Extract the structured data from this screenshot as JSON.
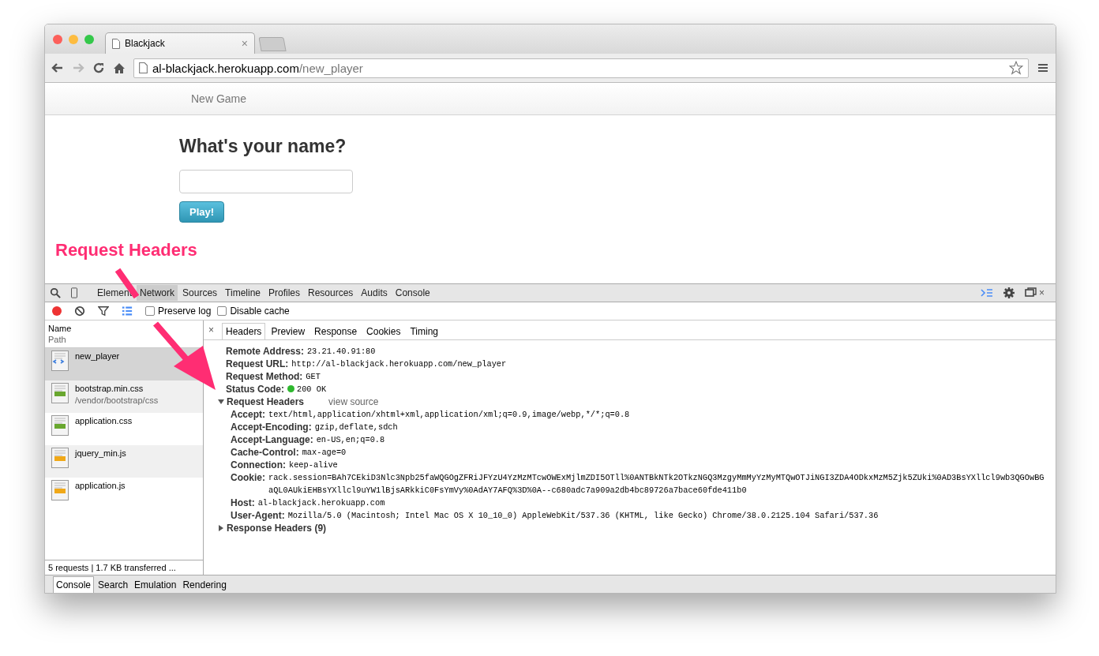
{
  "browser": {
    "tabs": [
      {
        "title": "Blackjack",
        "close": "×",
        "selected": true
      }
    ],
    "address": {
      "host": "al-blackjack.herokuapp.com",
      "path": "/new_player"
    }
  },
  "page": {
    "nav": {
      "link": "New Game"
    },
    "heading": "What's your name?",
    "play_button": "Play!"
  },
  "annotation": {
    "label": "Request Headers"
  },
  "devtools": {
    "panels": [
      {
        "label": "Element",
        "selected": false
      },
      {
        "label": "Network",
        "selected": true
      },
      {
        "label": "Sources",
        "selected": false
      },
      {
        "label": "Timeline",
        "selected": false
      },
      {
        "label": "Profiles",
        "selected": false
      },
      {
        "label": "Resources",
        "selected": false
      },
      {
        "label": "Audits",
        "selected": false
      },
      {
        "label": "Console",
        "selected": false
      }
    ],
    "close": "×",
    "toolbar": {
      "recording": true,
      "checkboxes": [
        {
          "label": "Preserve log",
          "checked": false
        },
        {
          "label": "Disable cache",
          "checked": false
        }
      ]
    },
    "requests_header": {
      "name": "Name",
      "path": "Path"
    },
    "requests": [
      {
        "name": "new_player",
        "kind": "html",
        "selected": true
      },
      {
        "name": "bootstrap.min.css",
        "path": "/vendor/bootstrap/css",
        "kind": "css",
        "selected": false
      },
      {
        "name": "application.css",
        "kind": "css",
        "selected": false
      },
      {
        "name": "jquery_min.js",
        "kind": "js",
        "selected": false
      },
      {
        "name": "application.js",
        "kind": "js",
        "selected": false
      }
    ],
    "summary": "5 requests | 1.7 KB transferred ...",
    "detail_close": "×",
    "detail_tabs": [
      {
        "label": "Headers",
        "selected": true
      },
      {
        "label": "Preview",
        "selected": false
      },
      {
        "label": "Response",
        "selected": false
      },
      {
        "label": "Cookies",
        "selected": false
      },
      {
        "label": "Timing",
        "selected": false
      }
    ],
    "general": [
      {
        "name": "Remote Address:",
        "value": "23.21.40.91:80"
      },
      {
        "name": "Request URL:",
        "value": "http://al-blackjack.herokuapp.com/new_player"
      },
      {
        "name": "Request Method:",
        "value": "GET"
      },
      {
        "name": "Status Code:",
        "value": "200 OK",
        "color": "#2eb82e"
      }
    ],
    "request_headers": {
      "title": "Request Headers",
      "expanded": true,
      "view_source": "view source",
      "items": [
        {
          "name": "Accept:",
          "value": "text/html,application/xhtml+xml,application/xml;q=0.9,image/webp,*/*;q=0.8"
        },
        {
          "name": "Accept-Encoding:",
          "value": "gzip,deflate,sdch"
        },
        {
          "name": "Accept-Language:",
          "value": "en-US,en;q=0.8"
        },
        {
          "name": "Cache-Control:",
          "value": "max-age=0"
        },
        {
          "name": "Connection:",
          "value": "keep-alive"
        },
        {
          "name": "Cookie:",
          "value": "rack.session=BAh7CEkiD3Nlc3Npb25faWQGOgZFRiJFYzU4YzMzMTcwOWExMjlmZDI5OTll%0ANTBkNTk2OTkzNGQ3MzgyMmMyYzMyMTQwOTJiNGI3ZDA4ODkxMzM5Zjk5ZUki%0AD3BsYXllcl9wb3QGOwBGaQL0AUkiEHBsYXllcl9uYW1lBjsARkkiC0FsYmVy%0AdAY7AFQ%3D%0A--c680adc7a909a2db4bc89726a7bace60fde411b0"
        },
        {
          "name": "Host:",
          "value": "al-blackjack.herokuapp.com"
        },
        {
          "name": "User-Agent:",
          "value": "Mozilla/5.0 (Macintosh; Intel Mac OS X 10_10_0) AppleWebKit/537.36 (KHTML, like Gecko) Chrome/38.0.2125.104 Safari/537.36"
        }
      ]
    },
    "response_headers": {
      "title": "Response Headers (9)",
      "expanded": false
    },
    "drawer_tabs": [
      {
        "label": "Console",
        "selected": true
      },
      {
        "label": "Search",
        "selected": false
      },
      {
        "label": "Emulation",
        "selected": false
      },
      {
        "label": "Rendering",
        "selected": false
      }
    ]
  }
}
